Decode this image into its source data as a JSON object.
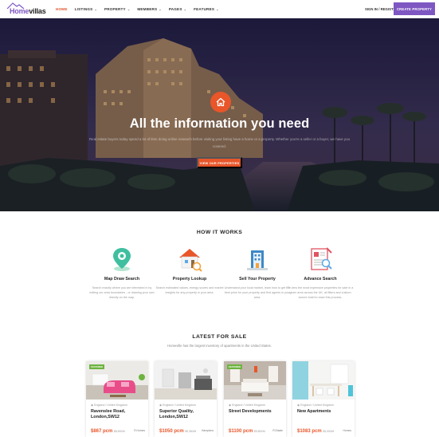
{
  "header": {
    "logo_part1": "Home",
    "logo_part2": "villas",
    "nav": [
      {
        "label": "HOME",
        "has_menu": false
      },
      {
        "label": "LISTINGS",
        "has_menu": true
      },
      {
        "label": "PROPERTY",
        "has_menu": true
      },
      {
        "label": "MEMBERS",
        "has_menu": true
      },
      {
        "label": "PAGES",
        "has_menu": true
      },
      {
        "label": "FEATURES",
        "has_menu": true
      }
    ],
    "signin": "SIGN IN / REGISTER",
    "create_button": "CREATE PROPERTY"
  },
  "hero": {
    "title": "All the information you need",
    "subtitle": "Real estate buyers today spend a lot of time doing online research before visiting your listing have a home or a property. Whether you're a seller or a buyer, we have you covered.",
    "button": "VIEW OUR PROPERTIES"
  },
  "how": {
    "title": "HOW IT WORKS",
    "features": [
      {
        "title": "Map Draw Search",
        "desc": "Search exactly where you are interested in by editing our area boundaries - or drawing your own directly on the map."
      },
      {
        "title": "Property Lookup",
        "desc": "Search estimated values, energy scores and market insights for any property in your area."
      },
      {
        "title": "Sell Your Property",
        "desc": "Understand your local market, learn how to get the best price for your property and find agents in your area."
      },
      {
        "title": "Advance Search",
        "desc": "To view the most expensive properties for sale in a given area across the UK, all filters and custom search build to ease this process."
      }
    ]
  },
  "listings": {
    "title": "LATEST FOR SALE",
    "subtitle": "Homeville has the largest inventory of apartments in the United States.",
    "cards": [
      {
        "tag": "FEATURED",
        "location": "England / United Kingdom",
        "title": "Ravenslee Road, London,SW12",
        "price": "$867 pcm",
        "price_unit": "$8,900/M",
        "agent": "R.Homes"
      },
      {
        "tag": "",
        "location": "England / United Kingdom",
        "title": "Superior Quality, London,SW12",
        "price": "$1050 pcm",
        "price_unit": "$9,350/M",
        "agent": "Hamptons"
      },
      {
        "tag": "FEATURED",
        "location": "England / United Kingdom",
        "title": "Street Developments",
        "price": "$1100 pcm",
        "price_unit": "$9,800/M",
        "agent": "R.Estate"
      },
      {
        "tag": "",
        "location": "England / United Kingdom",
        "title": "New Apartments",
        "price": "$1083 pcm",
        "price_unit": "$9,000/M",
        "agent": "Homes"
      }
    ]
  },
  "colors": {
    "accent": "#e8562a",
    "brand": "#7e57c2",
    "featured": "#6db33f"
  }
}
